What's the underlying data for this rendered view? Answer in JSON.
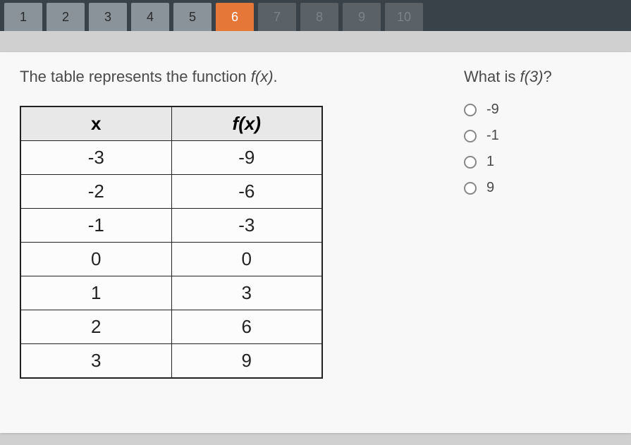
{
  "nav": {
    "tabs": [
      {
        "label": "1",
        "state": "normal"
      },
      {
        "label": "2",
        "state": "normal"
      },
      {
        "label": "3",
        "state": "normal"
      },
      {
        "label": "4",
        "state": "normal"
      },
      {
        "label": "5",
        "state": "normal"
      },
      {
        "label": "6",
        "state": "active"
      },
      {
        "label": "7",
        "state": "disabled"
      },
      {
        "label": "8",
        "state": "disabled"
      },
      {
        "label": "9",
        "state": "disabled"
      },
      {
        "label": "10",
        "state": "disabled"
      }
    ]
  },
  "question": {
    "prompt_prefix": "The table represents the function ",
    "prompt_fx": "f(x)",
    "prompt_suffix": ".",
    "answer_prefix": "What is ",
    "answer_fx": "f(3)",
    "answer_suffix": "?"
  },
  "table": {
    "header_x": "x",
    "header_fx": "f(x)",
    "rows": [
      {
        "x": "-3",
        "fx": "-9"
      },
      {
        "x": "-2",
        "fx": "-6"
      },
      {
        "x": "-1",
        "fx": "-3"
      },
      {
        "x": "0",
        "fx": "0"
      },
      {
        "x": "1",
        "fx": "3"
      },
      {
        "x": "2",
        "fx": "6"
      },
      {
        "x": "3",
        "fx": "9"
      }
    ]
  },
  "options": [
    {
      "label": "-9"
    },
    {
      "label": "-1"
    },
    {
      "label": "1"
    },
    {
      "label": "9"
    }
  ]
}
